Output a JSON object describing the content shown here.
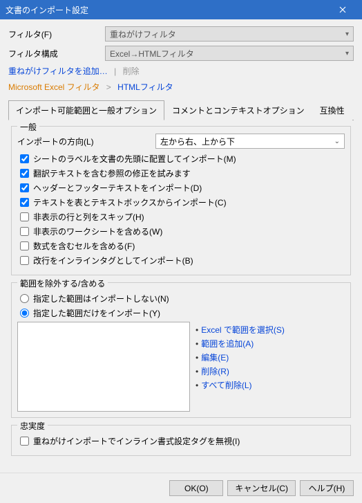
{
  "titlebar": {
    "title": "文書のインポート設定"
  },
  "filter": {
    "label": "フィルタ(F)",
    "value": "重ねがけフィルタ"
  },
  "filterConfig": {
    "label": "フィルタ構成",
    "value": "Excel→HTMLフィルタ"
  },
  "links": {
    "add": "重ねがけフィルタを追加…",
    "delete": "削除",
    "excel": "Microsoft Excel フィルタ",
    "arrow": ">",
    "html": "HTMLフィルタ"
  },
  "tabs": {
    "t1": "インポート可能範囲と一般オプション",
    "t2": "コメントとコンテキストオプション",
    "t3": "互換性"
  },
  "general": {
    "title": "一般",
    "direction": {
      "label": "インポートの方向(L)",
      "value": "左から右、上から下"
    },
    "chk1": "シートのラベルを文書の先頭に配置してインポート(M)",
    "chk2": "翻訳テキストを含む参照の修正を試みます",
    "chk3": "ヘッダーとフッターテキストをインポート(D)",
    "chk4": "テキストを表とテキストボックスからインポート(C)",
    "chk5": "非表示の行と列をスキップ(H)",
    "chk6": "非表示のワークシートを含める(W)",
    "chk7": "数式を含むセルを含める(F)",
    "chk8": "改行をインラインタグとしてインポート(B)"
  },
  "range": {
    "title": "範囲を除外する/含める",
    "r1": "指定した範囲はインポートしない(N)",
    "r2": "指定した範囲だけをインポート(Y)",
    "links": {
      "l1": "Excel で範囲を選択(S)",
      "l2": "範囲を追加(A)",
      "l3": "編集(E)",
      "l4": "削除(R)",
      "l5": "すべて削除(L)"
    }
  },
  "fidelity": {
    "title": "忠実度",
    "chk1": "重ねがけインポートでインライン書式設定タグを無視(I)"
  },
  "buttons": {
    "ok": "OK(O)",
    "cancel": "キャンセル(C)",
    "help": "ヘルプ(H)"
  }
}
